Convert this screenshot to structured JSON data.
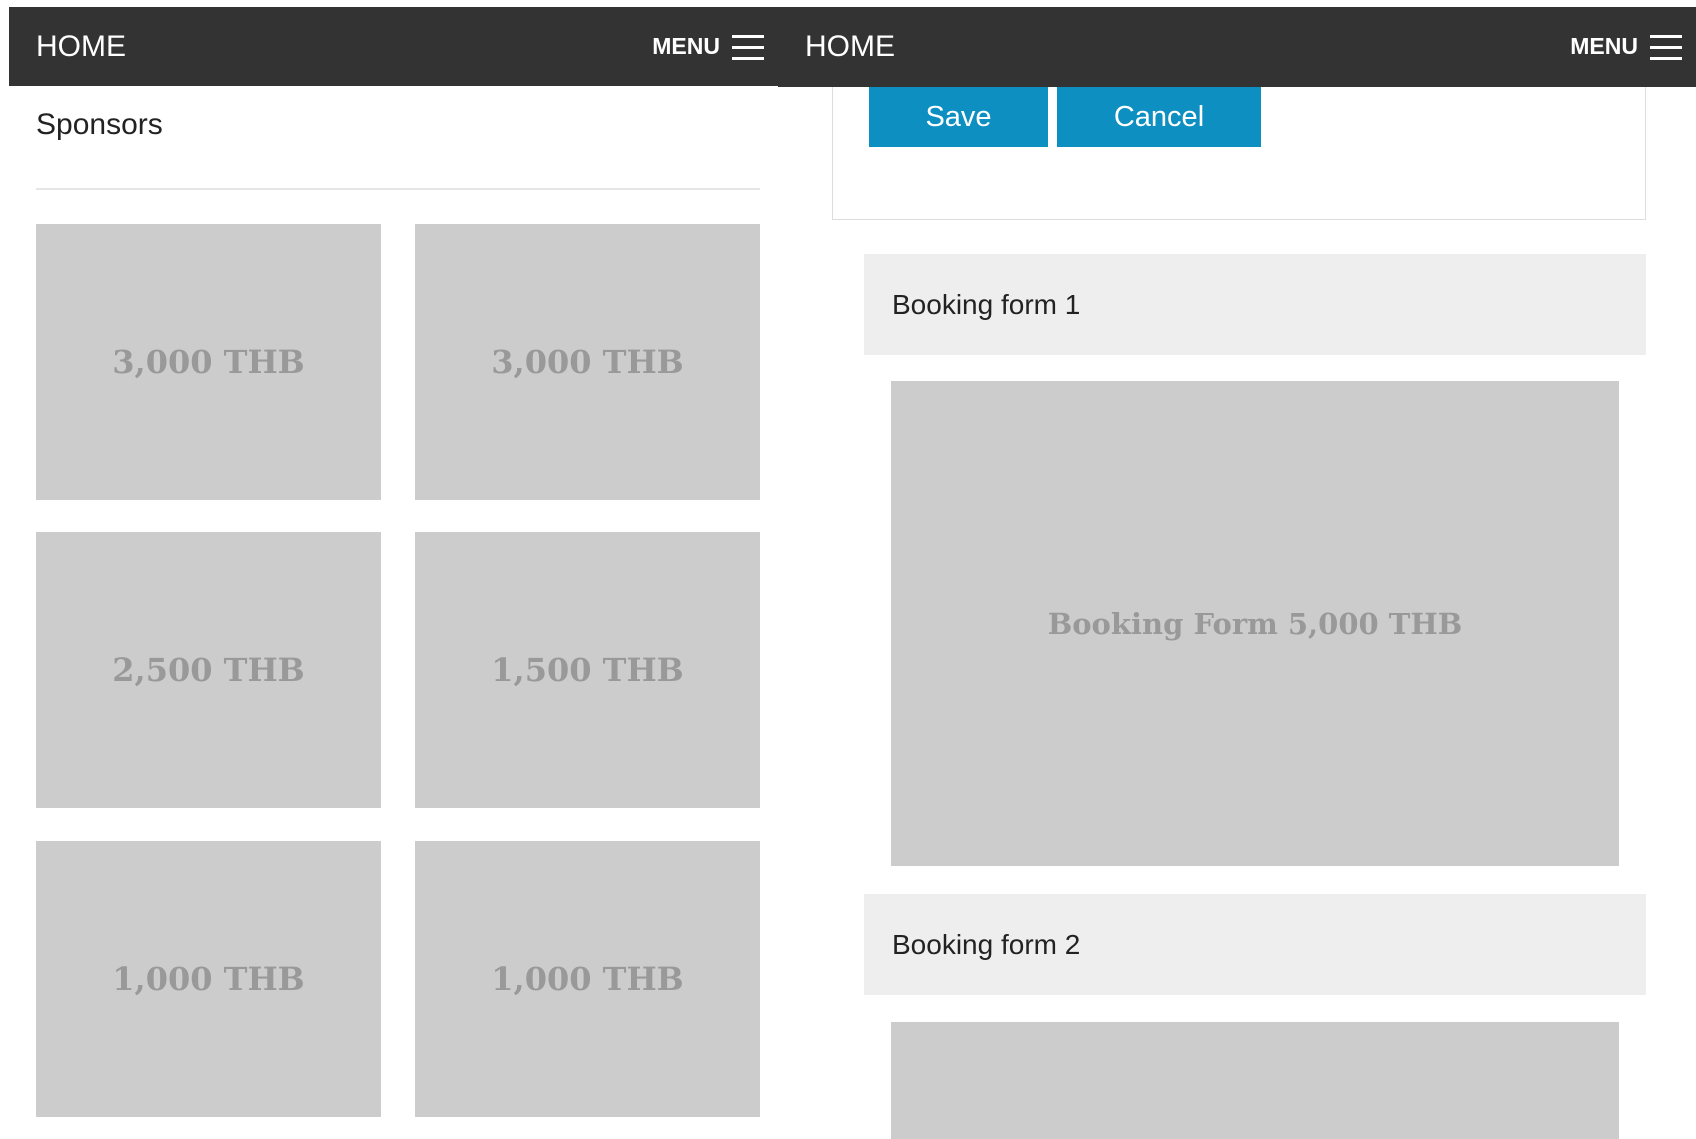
{
  "left": {
    "header": {
      "home_label": "HOME",
      "menu_label": "MENU"
    },
    "section_title": "Sponsors",
    "tiles": [
      "3,000 THB",
      "3,000 THB",
      "2,500 THB",
      "1,500 THB",
      "1,000 THB",
      "1,000 THB"
    ]
  },
  "right": {
    "header": {
      "home_label": "HOME",
      "menu_label": "MENU"
    },
    "form": {
      "save_label": "Save",
      "cancel_label": "Cancel"
    },
    "booking_forms": [
      {
        "title": "Booking form 1",
        "image_text": "Booking Form 5,000 THB"
      },
      {
        "title": "Booking form 2",
        "image_text": ""
      }
    ]
  },
  "colors": {
    "topbar": "#333333",
    "button": "#0d8fc2",
    "placeholder": "#cccccc",
    "placeholder_text": "#999999",
    "section_bg": "#eeeeee"
  }
}
